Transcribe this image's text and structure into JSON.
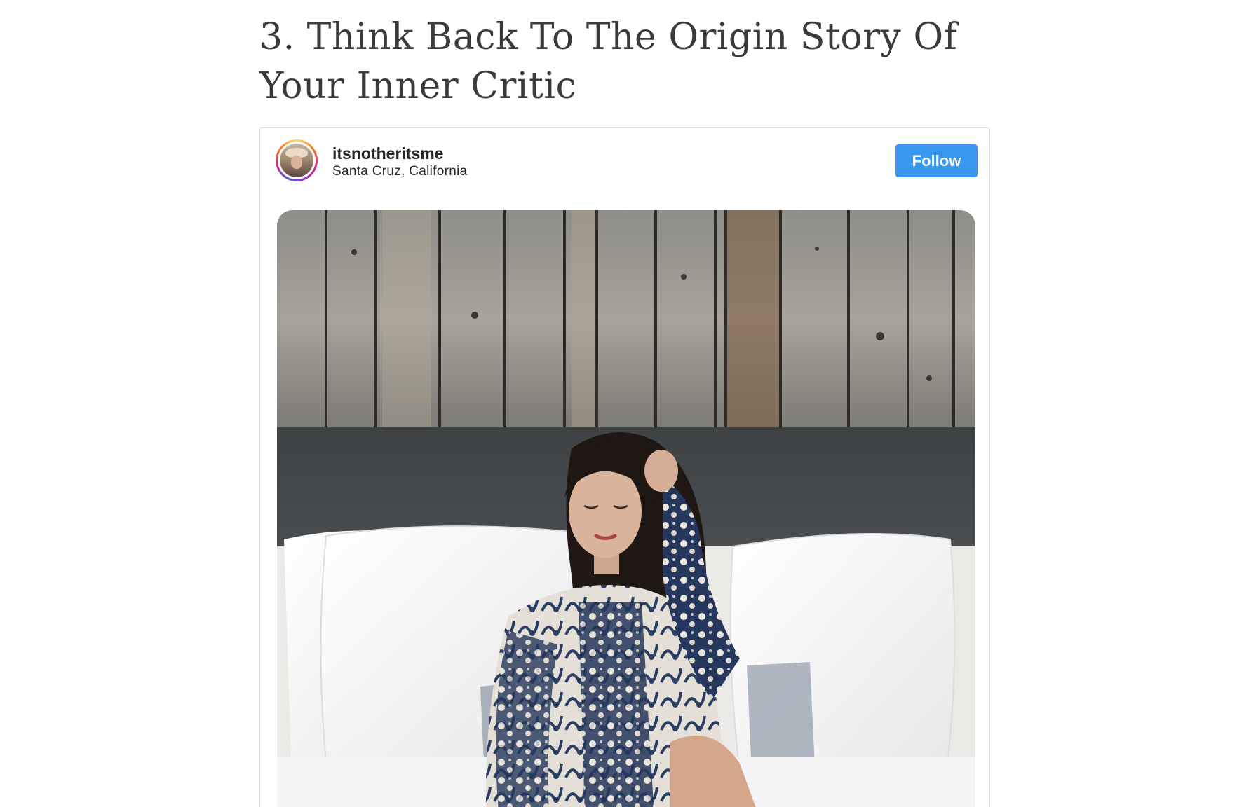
{
  "article": {
    "heading": "3. Think Back To The Origin Story Of Your Inner Critic"
  },
  "embed": {
    "username": "itsnotheritsme",
    "location": "Santa Cruz, California",
    "follow_label": "Follow",
    "follow_color": "#3897f0"
  }
}
